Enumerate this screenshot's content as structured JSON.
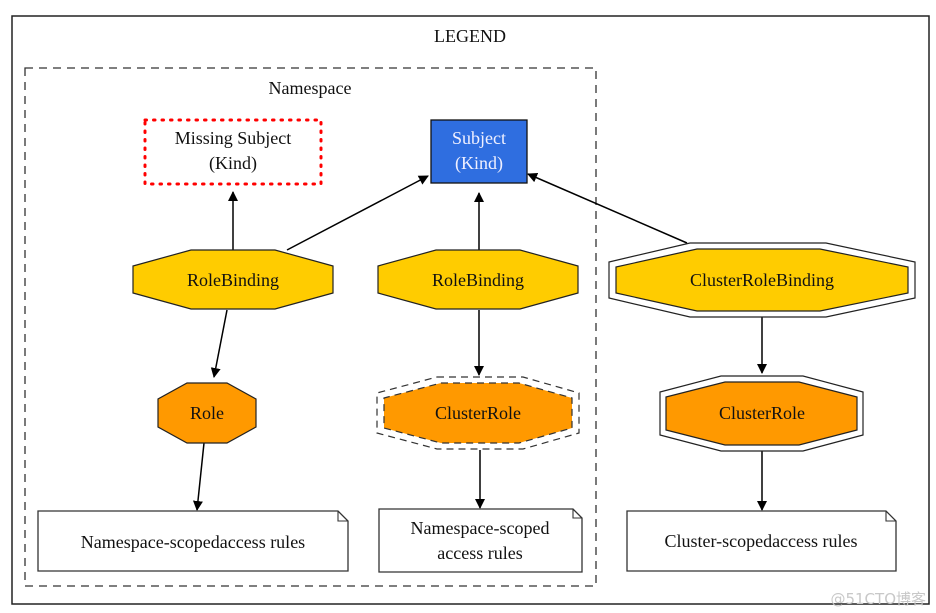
{
  "legend": {
    "title": "LEGEND",
    "namespace_label": "Namespace"
  },
  "nodes": {
    "missing_subject": {
      "line1": "Missing Subject",
      "line2": "(Kind)"
    },
    "subject": {
      "line1": "Subject",
      "line2": "(Kind)"
    },
    "rolebinding_left": "RoleBinding",
    "rolebinding_mid": "RoleBinding",
    "clusterrolebinding": "ClusterRoleBinding",
    "role": "Role",
    "clusterrole_ns": "ClusterRole",
    "clusterrole_cluster": "ClusterRole",
    "rules_ns_left": "Namespace-scopedaccess rules",
    "rules_ns_mid": {
      "line1": "Namespace-scoped",
      "line2": "access rules"
    },
    "rules_cluster": "Cluster-scopedaccess rules"
  },
  "colors": {
    "subject_fill": "#2f6ee0",
    "binding_fill": "#ffcc00",
    "role_fill": "#ff9900",
    "missing_border": "#ff0000"
  },
  "watermark": "@51CTO博客"
}
